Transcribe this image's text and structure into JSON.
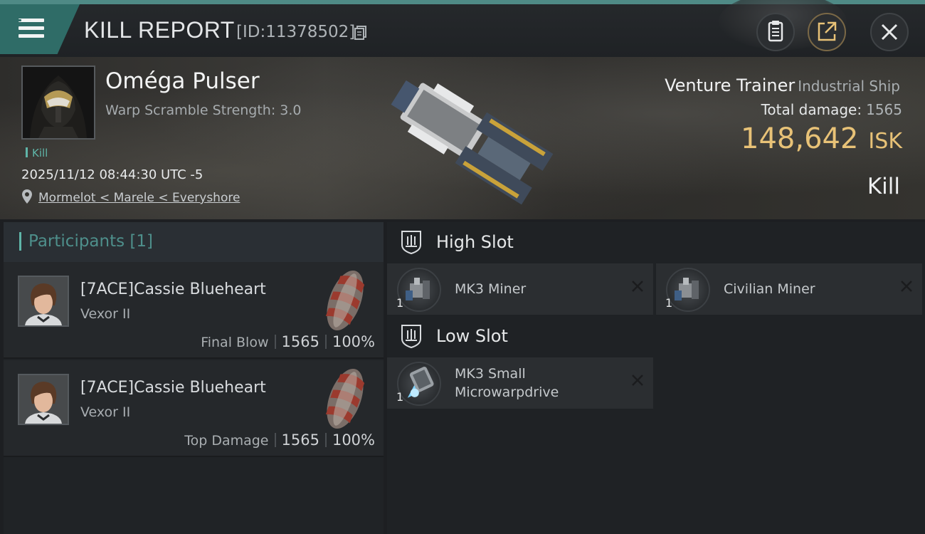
{
  "header": {
    "title": "KILL REPORT",
    "report_id": "[ID:11378502]",
    "icons": [
      "menu-icon",
      "copy-icon",
      "clipboard-icon",
      "share-icon",
      "close-icon"
    ]
  },
  "victim": {
    "name": "Oméga Pulser",
    "warp_scramble": "Warp Scramble Strength: 3.0",
    "tag": "Kill",
    "datetime": "2025/11/12 08:44:30 UTC -5",
    "location": "Mormelot < Marele < Everyshore"
  },
  "ship": {
    "name": "Venture Trainer",
    "class": "Industrial Ship",
    "total_damage_label": "Total damage:",
    "total_damage": "1565",
    "isk_value": "148,642",
    "isk_unit": "ISK",
    "result": "Kill"
  },
  "participants": {
    "title": "Participants [1]",
    "rows": [
      {
        "name": "[7ACE]Cassie Blueheart",
        "ship": "Vexor II",
        "label": "Final Blow",
        "damage": "1565",
        "percent": "100%"
      },
      {
        "name": "[7ACE]Cassie Blueheart",
        "ship": "Vexor II",
        "label": "Top Damage",
        "damage": "1565",
        "percent": "100%"
      }
    ]
  },
  "fitting": {
    "high_slot": {
      "label": "High Slot",
      "modules": [
        {
          "name": "MK3 Miner",
          "qty": "1"
        },
        {
          "name": "Civilian Miner",
          "qty": "1"
        }
      ]
    },
    "low_slot": {
      "label": "Low Slot",
      "modules": [
        {
          "name_line1": "MK3 Small",
          "name_line2": "Microwarpdrive",
          "qty": "1"
        }
      ]
    }
  },
  "colors": {
    "accent_teal": "#4f8a86",
    "isk_gold": "#e8c277",
    "participants_title": "#4e8f8b"
  }
}
